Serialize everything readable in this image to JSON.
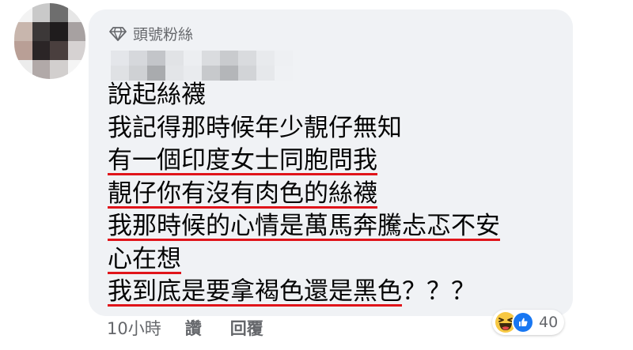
{
  "badge": {
    "label": "頭號粉絲",
    "icon": "diamond-icon"
  },
  "comment": {
    "lines": [
      {
        "text": "說起絲襪",
        "underlined": false
      },
      {
        "text": "我記得那時候年少靚仔無知",
        "underlined": false
      },
      {
        "text": "有一個印度女士同胞問我",
        "underlined": true
      },
      {
        "text": "靚仔你有沒有肉色的絲襪",
        "underlined": true
      },
      {
        "text": "我那時候的心情是萬馬奔騰忐忑不安",
        "underlined": true
      },
      {
        "text": "心在想",
        "underlined": true
      },
      {
        "text": "我到底是要拿褐色還是黑色",
        "underlined": true,
        "suffix": "？？？"
      }
    ]
  },
  "actions": {
    "time": "10小時",
    "like": "讚",
    "reply": "回覆"
  },
  "reactions": {
    "icons": [
      "laughing-emoji-icon",
      "thumbs-up-icon"
    ],
    "count": "40"
  },
  "colors": {
    "bubble": "#f0f2f5",
    "text": "#050505",
    "secondary_text": "#65676b",
    "underline": "#e0141a",
    "like_blue": "#1877f2",
    "haha_yellow": "#f7c843"
  }
}
